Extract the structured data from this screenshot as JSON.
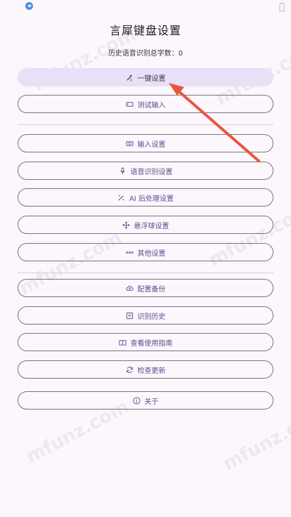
{
  "header": {
    "title": "言犀键盘设置",
    "history_label": "历史语音识别总字数：0"
  },
  "buttons": {
    "one_key": "一键设置",
    "test_input": "测试输入",
    "input_settings": "输入设置",
    "voice_settings": "语音识别设置",
    "ai_settings": "AI 后处理设置",
    "float_ball": "悬浮球设置",
    "other": "其他设置",
    "backup": "配置备份",
    "history": "识别历史",
    "guide": "查看使用指南",
    "update": "检查更新",
    "about": "关于"
  },
  "watermark": {
    "text": "mfunz.com"
  },
  "colors": {
    "accent": "#e8e0f6",
    "arrow": "#e8553f",
    "background": "#fcf6fd"
  }
}
